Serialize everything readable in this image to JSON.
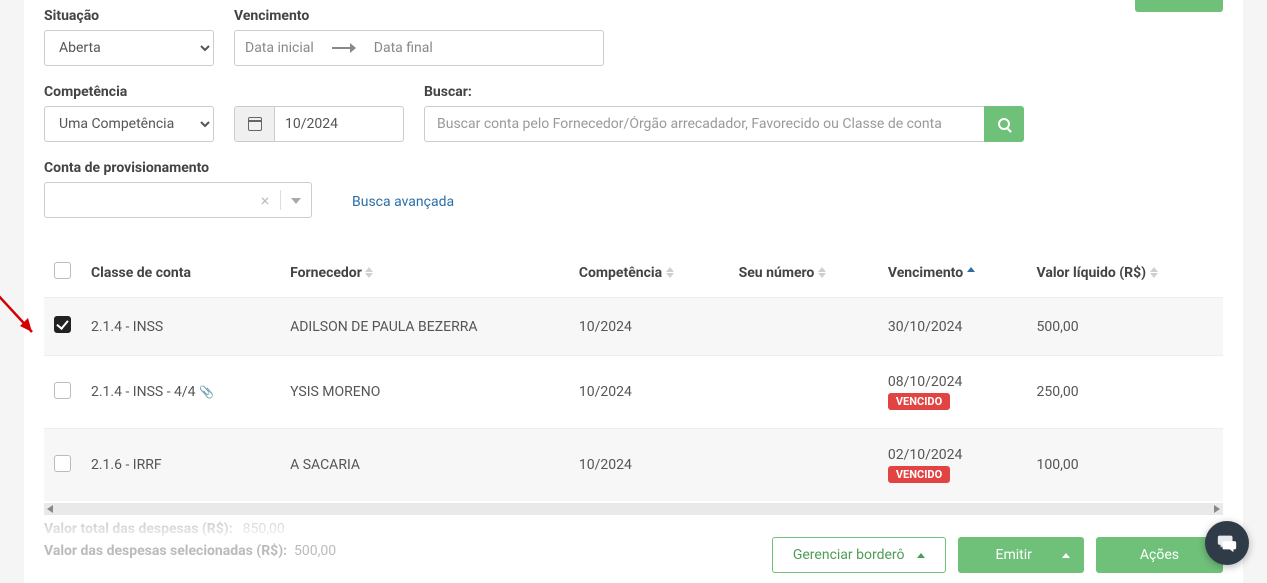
{
  "filters": {
    "situacao": {
      "label": "Situação",
      "value": "Aberta"
    },
    "vencimento": {
      "label": "Vencimento",
      "from_placeholder": "Data inicial",
      "to_placeholder": "Data final"
    },
    "competencia": {
      "label": "Competência",
      "mode_value": "Uma Competência",
      "value": "10/2024"
    },
    "buscar": {
      "label": "Buscar:",
      "placeholder": "Buscar conta pelo Fornecedor/Órgão arrecadador, Favorecido ou Classe de conta"
    },
    "provisionamento": {
      "label": "Conta de provisionamento"
    },
    "advanced_link": "Busca avançada"
  },
  "table": {
    "headers": {
      "classe": "Classe de conta",
      "fornecedor": "Fornecedor",
      "competencia": "Competência",
      "seu_numero": "Seu número",
      "vencimento": "Vencimento",
      "valor": "Valor líquido (R$)"
    },
    "rows": [
      {
        "checked": true,
        "classe": "2.1.4 - INSS",
        "has_attachment": false,
        "fornecedor": "ADILSON DE PAULA BEZERRA",
        "competencia": "10/2024",
        "vencimento": "30/10/2024",
        "overdue": false,
        "valor": "500,00"
      },
      {
        "checked": false,
        "classe": "2.1.4 - INSS - 4/4",
        "has_attachment": true,
        "fornecedor": "YSIS MORENO",
        "competencia": "10/2024",
        "vencimento": "08/10/2024",
        "overdue": true,
        "valor": "250,00"
      },
      {
        "checked": false,
        "classe": "2.1.6 - IRRF",
        "has_attachment": false,
        "fornecedor": "A SACARIA",
        "competencia": "10/2024",
        "vencimento": "02/10/2024",
        "overdue": true,
        "valor": "100,00"
      }
    ],
    "overdue_badge": "VENCIDO"
  },
  "totals": {
    "total_label": "Valor total das despesas (R$):",
    "total_value": "850,00",
    "selected_label": "Valor das despesas selecionadas (R$):",
    "selected_value": "500,00"
  },
  "actions": {
    "bordero": "Gerenciar borderô",
    "emitir": "Emitir",
    "acoes": "Ações"
  }
}
